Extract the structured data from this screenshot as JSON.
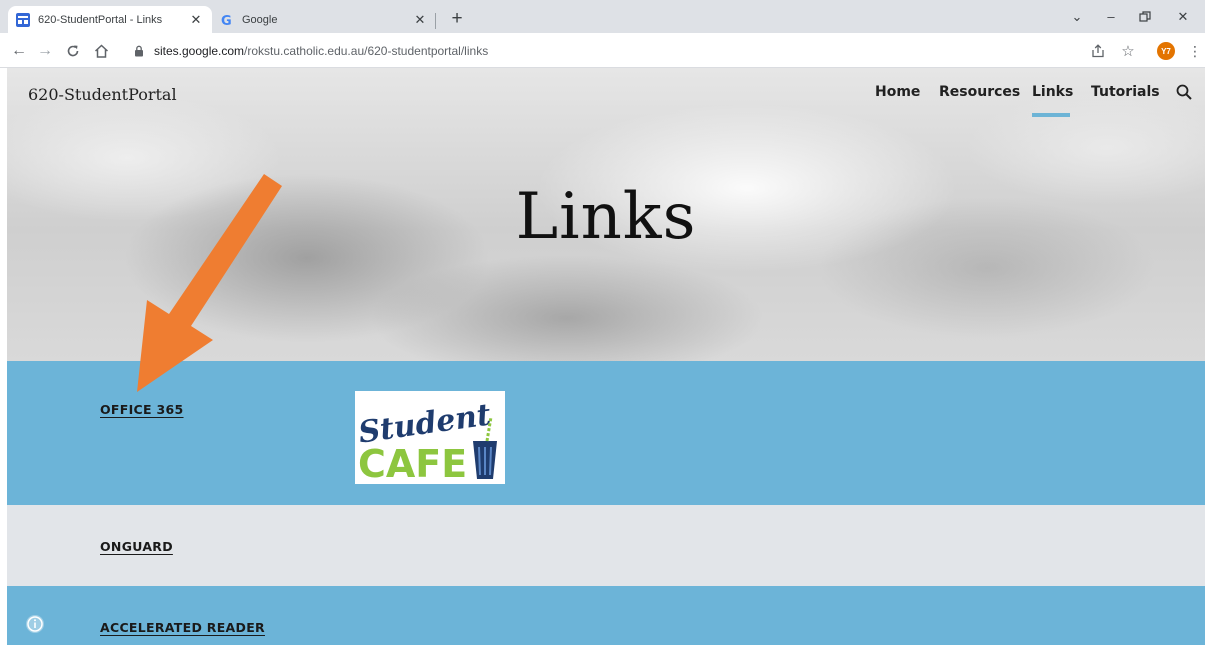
{
  "browser": {
    "tabs": [
      {
        "title": "620-StudentPortal - Links",
        "active": true,
        "favicon": "google-sites-icon"
      },
      {
        "title": "Google",
        "active": false,
        "favicon": "google-g-icon"
      }
    ],
    "new_tab_label": "+",
    "url_host": "sites.google.com",
    "url_path": "/rokstu.catholic.edu.au/620-studentportal/links",
    "profile_initials": "Y7",
    "profile_color": "#e37400"
  },
  "site": {
    "title": "620-StudentPortal",
    "nav": [
      {
        "label": "Home"
      },
      {
        "label": "Resources"
      },
      {
        "label": "Links",
        "active": true
      },
      {
        "label": "Tutorials"
      }
    ],
    "hero_title": "Links",
    "accent_color": "#6cb4d8"
  },
  "links": [
    {
      "label": "OFFICE 365"
    },
    {
      "label": "ONGUARD"
    },
    {
      "label": "ACCELERATED READER"
    }
  ],
  "logo": {
    "line1": "Student",
    "line2": "CAFE"
  },
  "annotation_color": "#ef7d31"
}
